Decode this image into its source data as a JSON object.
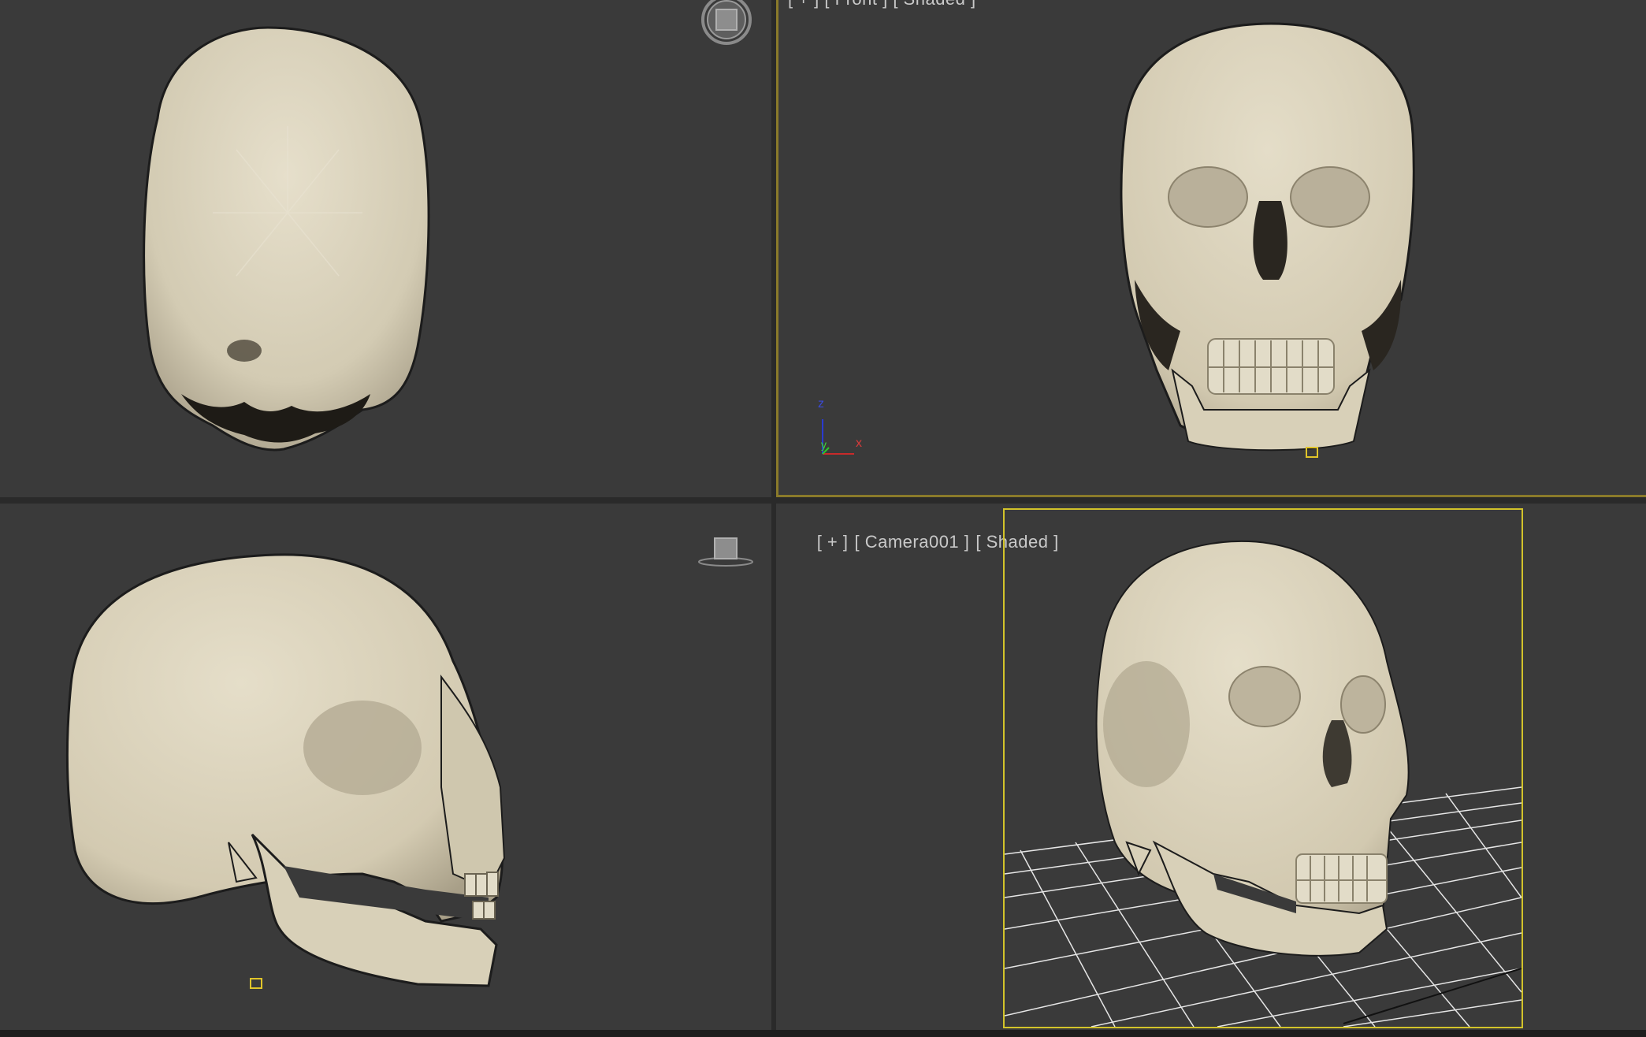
{
  "viewports": {
    "top": {
      "label": ""
    },
    "front": {
      "label": "[ + ] [ Front ] [ Shaded ]"
    },
    "left": {
      "label": ""
    },
    "camera": {
      "label_plus": "[ + ]",
      "label_camera": "[ Camera001 ]",
      "label_shading": "[ Shaded ]"
    }
  },
  "axis_gizmo": {
    "z": "z",
    "x": "x",
    "y": "y"
  },
  "colors": {
    "viewport_bg": "#3a3a3a",
    "active_border": "#8a7a2a",
    "safe_frame": "#d2c32a",
    "bone": "#d9d2bd"
  },
  "icons": {
    "viewcube_top": "viewcube-top-icon",
    "viewcube_left": "viewcube-left-icon"
  }
}
